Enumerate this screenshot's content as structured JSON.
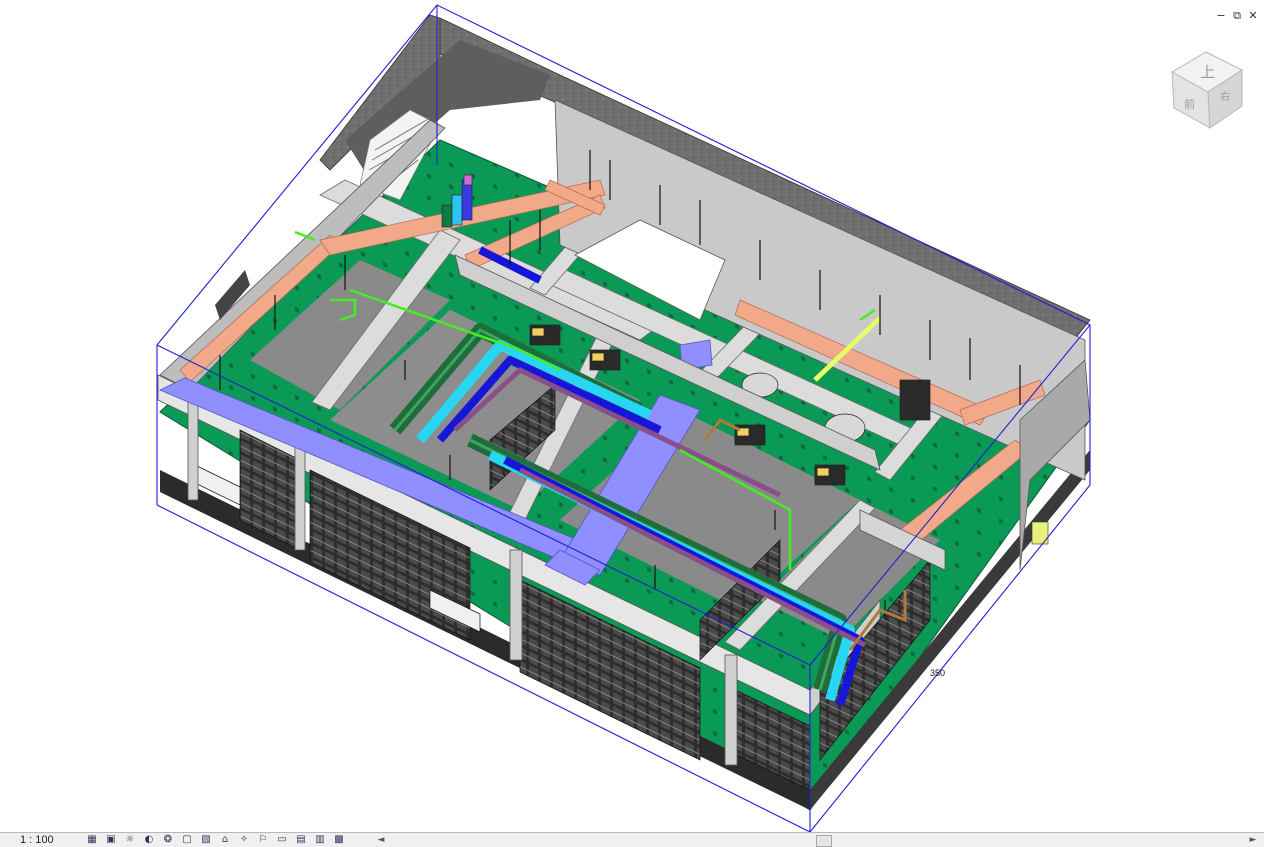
{
  "window": {
    "minimize_glyph": "−",
    "restore_glyph": "⧉",
    "close_glyph": "✕"
  },
  "viewport": {
    "section_box_color": "#1f1fd6",
    "floor_color": "#0a9a55",
    "wall_color": "#d8d8d8",
    "slab_color": "#7d7d7d",
    "duct_supply_color": "#8f8fff",
    "pipe_blue_color": "#1616d8",
    "pipe_cyan_color": "#27d6f2",
    "pipe_green_color": "#1d6e3a",
    "duct_salmon_color": "#f2a98a",
    "pipe_lime_color": "#44ee22"
  },
  "viewcube": {
    "top_face_label": "上",
    "front_face_label": "前",
    "right_face_label": "右"
  },
  "status_bar": {
    "scale": "1 : 100",
    "tools": [
      {
        "icon": "detail-level-icon",
        "glyph": "▦"
      },
      {
        "icon": "visual-style-icon",
        "glyph": "▣"
      },
      {
        "icon": "sun-path-icon",
        "glyph": "☼"
      },
      {
        "icon": "shadows-icon",
        "glyph": "◐"
      },
      {
        "icon": "rendering-icon",
        "glyph": "❂"
      },
      {
        "icon": "crop-view-icon",
        "glyph": "▢"
      },
      {
        "icon": "show-crop-region-icon",
        "glyph": "▧"
      },
      {
        "icon": "unlocked-3d-view-icon",
        "glyph": "⌂"
      },
      {
        "icon": "temporary-hide-icon",
        "glyph": "✧"
      },
      {
        "icon": "reveal-hidden-icon",
        "glyph": "⚐"
      },
      {
        "icon": "temporary-view-properties-icon",
        "glyph": "▭"
      },
      {
        "icon": "worksharing-display-icon",
        "glyph": "▤"
      },
      {
        "icon": "analytical-model-icon",
        "glyph": "▥"
      },
      {
        "icon": "highlight-displacement-icon",
        "glyph": "▩"
      }
    ],
    "scroll_left_glyph": "◄",
    "scroll_right_glyph": "►"
  }
}
